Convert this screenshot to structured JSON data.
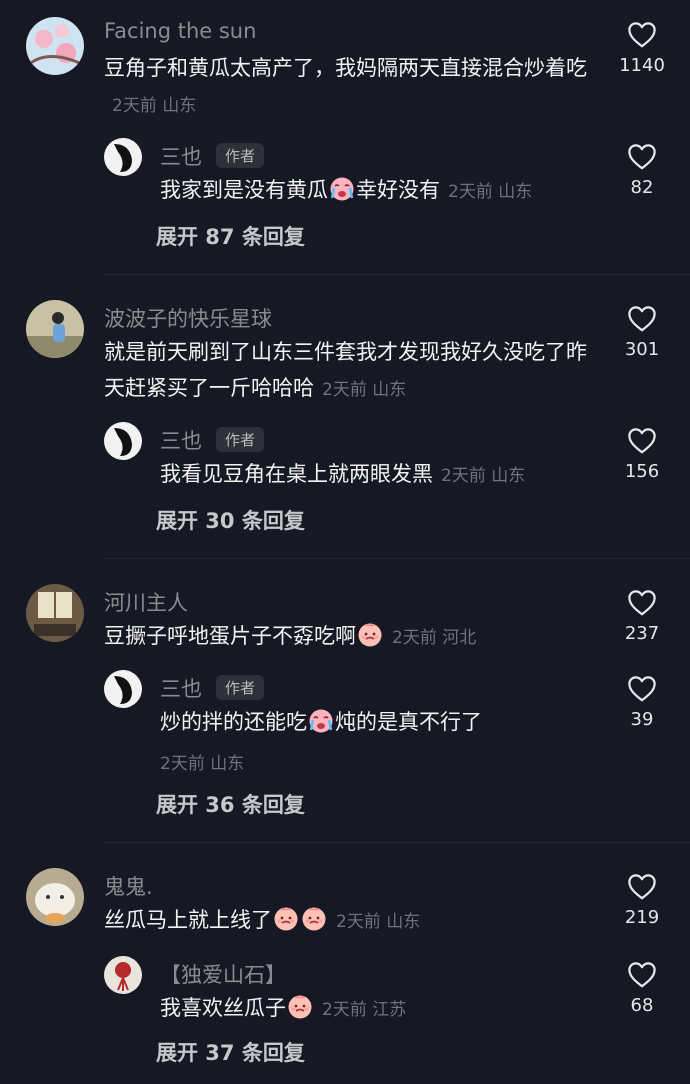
{
  "threads": [
    {
      "comment": {
        "user": "Facing the sun",
        "text": "豆角子和黄瓜太高产了，我妈隔两天直接混合炒着吃",
        "time": "2天前",
        "region": "山东",
        "likes": "1140"
      },
      "reply": {
        "user": "三也",
        "badge": "作者",
        "text_a": "我家到是没有黄瓜",
        "text_b": "幸好没有",
        "time": "2天前",
        "region": "山东",
        "likes": "82"
      },
      "expand": "展开 87 条回复"
    },
    {
      "comment": {
        "user": "波波子的快乐星球",
        "text": "就是前天刷到了山东三件套我才发现我好久没吃了昨天赶紧买了一斤哈哈哈",
        "time": "2天前",
        "region": "山东",
        "likes": "301"
      },
      "reply": {
        "user": "三也",
        "badge": "作者",
        "text": "我看见豆角在桌上就两眼发黑",
        "time": "2天前",
        "region": "山东",
        "likes": "156"
      },
      "expand": "展开 30 条回复"
    },
    {
      "comment": {
        "user": "河川主人",
        "text": "豆撅子呼地蛋片子不孬吃啊",
        "time": "2天前",
        "region": "河北",
        "likes": "237"
      },
      "reply": {
        "user": "三也",
        "badge": "作者",
        "text_a": "炒的拌的还能吃",
        "text_b": "炖的是真不行了",
        "time": "2天前",
        "region": "山东",
        "likes": "39"
      },
      "expand": "展开 36 条回复"
    },
    {
      "comment": {
        "user": "鬼鬼.",
        "text": "丝瓜马上就上线了",
        "time": "2天前",
        "region": "山东",
        "likes": "219"
      },
      "reply": {
        "user": "【独爱山石】",
        "text": "我喜欢丝瓜子",
        "time": "2天前",
        "region": "江苏",
        "likes": "68"
      },
      "expand": "展开 37 条回复"
    }
  ],
  "colors": {
    "background": "#161823",
    "secondary_text": "#8a8b91",
    "primary_text": "#f3f3f5"
  },
  "icons": [
    "heart-outline-icon",
    "crying-emoji-icon",
    "grimace-emoji-icon"
  ]
}
